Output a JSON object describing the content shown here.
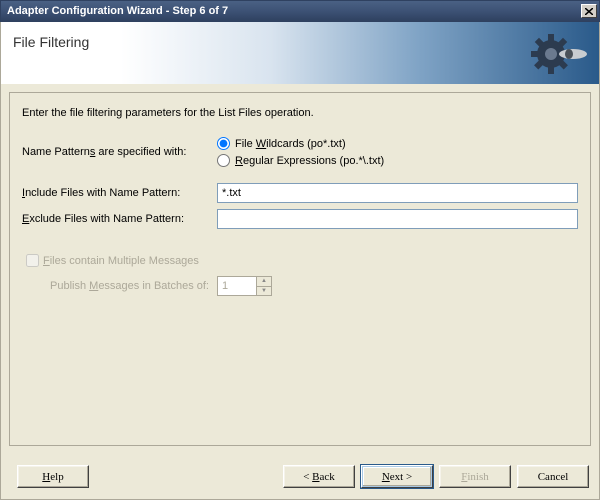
{
  "window": {
    "title": "Adapter Configuration Wizard - Step 6 of 7"
  },
  "header": {
    "heading": "File Filtering"
  },
  "content": {
    "instruction": "Enter the file filtering parameters for the List Files operation.",
    "patternLabel_pre": "Name Pattern",
    "patternLabel_hot": "s",
    "patternLabel_post": " are specified with:",
    "radio1_pre": "File ",
    "radio1_hot": "W",
    "radio1_post": "ildcards (po*.txt)",
    "radio2_hot": "R",
    "radio2_post": "egular Expressions (po.*\\.txt)",
    "radioSelected": "wildcards",
    "includeLabel_hot": "I",
    "includeLabel_post": "nclude Files with Name Pattern:",
    "includeValue": "*.txt",
    "excludeLabel_hot": "E",
    "excludeLabel_post": "xclude Files with Name Pattern:",
    "excludeValue": "",
    "multiLabel_hot": "F",
    "multiLabel_post": "iles contain Multiple Messages",
    "batchLabel_pre": "Publish ",
    "batchLabel_hot": "M",
    "batchLabel_post": "essages in Batches of:",
    "batchValue": "1"
  },
  "footer": {
    "help_hot": "H",
    "help_post": "elp",
    "back_pre": "< ",
    "back_hot": "B",
    "back_post": "ack",
    "next_hot": "N",
    "next_post": "ext >",
    "finish_hot": "F",
    "finish_post": "inish",
    "cancel": "Cancel"
  }
}
